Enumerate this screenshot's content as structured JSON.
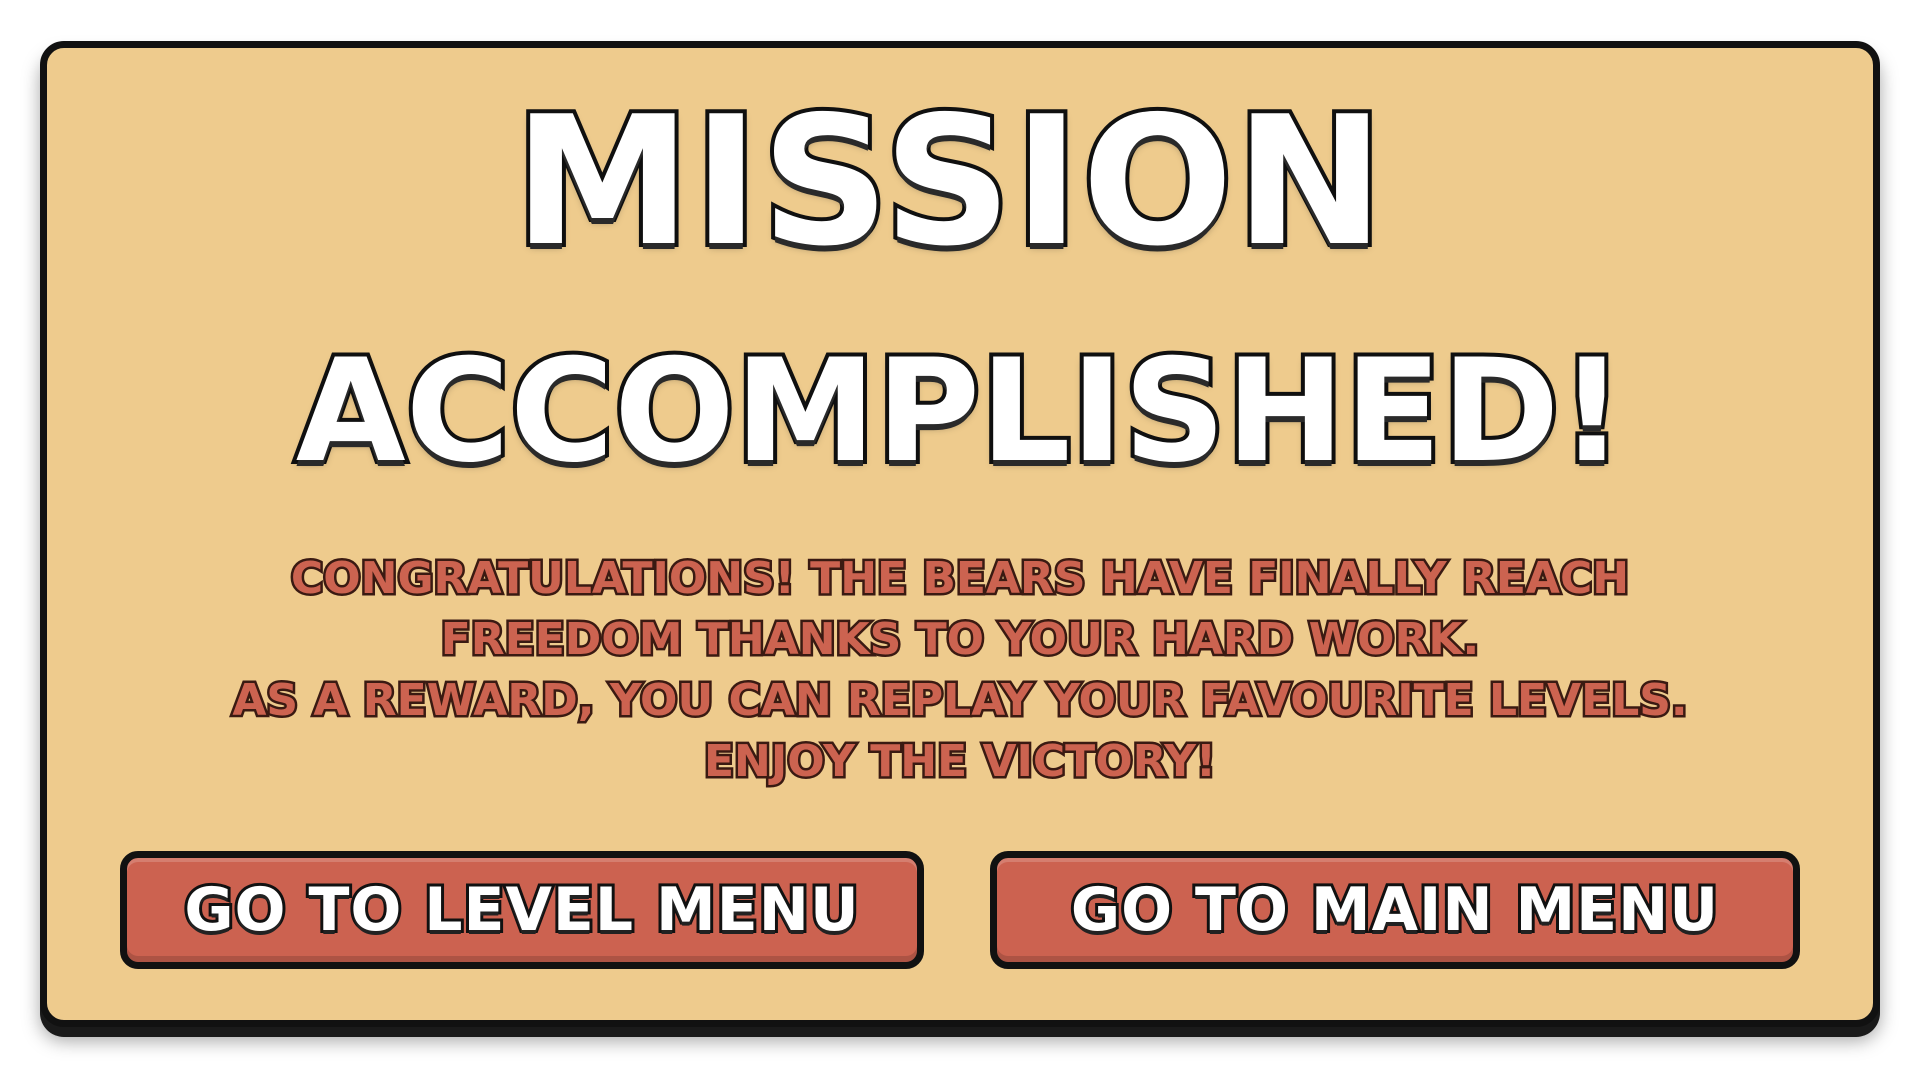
{
  "screen": {
    "title_line1": "MISSION",
    "title_line2": "ACCOMPLISHED!",
    "message_lines": [
      "CONGRATULATIONS! THE BEARS HAVE FINALLY REACH",
      "FREEDOM THANKS TO YOUR HARD WORK.",
      "AS A REWARD, YOU CAN REPLAY YOUR FAVOURITE LEVELS.",
      "ENJOY THE VICTORY!"
    ]
  },
  "buttons": {
    "level_menu_label": "GO TO LEVEL MENU",
    "main_menu_label": "GO TO MAIN MENU"
  },
  "colors": {
    "panel_background": "#eecb8d",
    "button_fill": "#cc6250",
    "message_text": "#cc6350",
    "outline": "#111111",
    "title_text": "#ffffff"
  }
}
